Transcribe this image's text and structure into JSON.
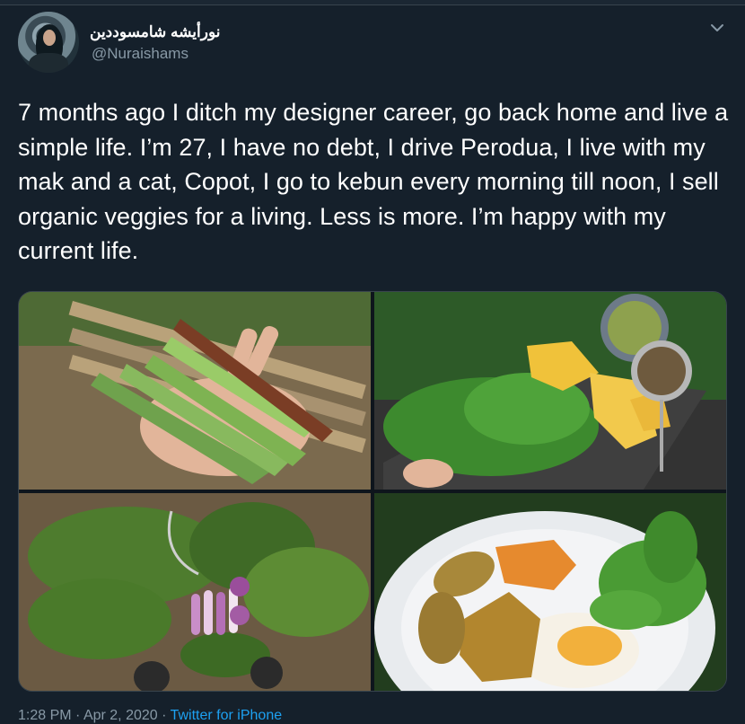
{
  "user": {
    "display_name": "نورأيشه شامسوددين",
    "handle": "@Nuraishams"
  },
  "tweet": {
    "text": "7 months ago I ditch my designer career, go back home and live a simple life. I’m 27, I have no debt, I drive Perodua, I live with my mak and a cat, Copot, I go to kebun every morning till noon, I sell organic veggies for a living. Less is more. I’m happy with my current life."
  },
  "footer": {
    "time": "1:28 PM",
    "separator1": " · ",
    "date": "Apr 2, 2020",
    "separator2": " · ",
    "source": "Twitter for iPhone"
  },
  "icons": {
    "more": "chevron-down-icon"
  },
  "colors": {
    "background": "#15202b",
    "secondary_text": "#8899a6",
    "link": "#1da1f2"
  }
}
